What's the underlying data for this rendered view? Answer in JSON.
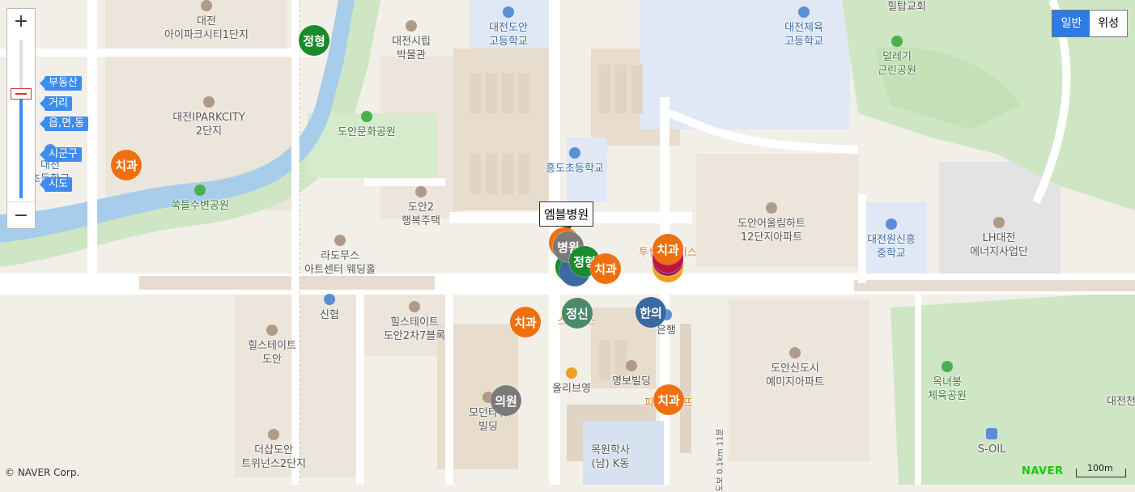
{
  "map_type": {
    "general": "일반",
    "satellite": "위성",
    "selected": "general"
  },
  "zoom": {
    "in": "+",
    "out": "−",
    "labels": [
      "부동산",
      "거리",
      "읍,면,동",
      "시군구",
      "시도"
    ],
    "level_fraction": 0.35
  },
  "tooltip": "엠블병원",
  "places": [
    {
      "name": "대전\n아이파크시티1단지",
      "kind": "bld"
    },
    {
      "name": "대전시립\n박물관",
      "kind": "bld"
    },
    {
      "name": "대전도안\n고등학교",
      "kind": "school"
    },
    {
      "name": "대전체육\n고등학교",
      "kind": "school"
    },
    {
      "name": "힐탑교회",
      "kind": "text"
    },
    {
      "name": "덜레기\n근린공원",
      "kind": "park"
    },
    {
      "name": "대전IPARKCITY\n2단지",
      "kind": "bld"
    },
    {
      "name": "도안문화공원",
      "kind": "park"
    },
    {
      "name": "흥도초등학교",
      "kind": "school"
    },
    {
      "name": "대전\n초등학교",
      "kind": "school"
    },
    {
      "name": "쑥들수변공원",
      "kind": "park"
    },
    {
      "name": "도안2\n행복주택",
      "kind": "bld"
    },
    {
      "name": "도안어울림하트\n12단지아파트",
      "kind": "bld"
    },
    {
      "name": "대전원신흥\n중학교",
      "kind": "school"
    },
    {
      "name": "LH대전\n에너지사업단",
      "kind": "bld"
    },
    {
      "name": "라도무스\n아트센터 웨딩홀",
      "kind": "bld"
    },
    {
      "name": "투썸플레이스",
      "kind": "orange"
    },
    {
      "name": "신협",
      "kind": "bank"
    },
    {
      "name": "힐스테이트\n도안2차7블록",
      "kind": "bld"
    },
    {
      "name": "스타벅스",
      "kind": "orange"
    },
    {
      "name": "은행",
      "kind": "bank"
    },
    {
      "name": "힐스테이트\n도안",
      "kind": "bld"
    },
    {
      "name": "올리브영",
      "kind": "shop"
    },
    {
      "name": "명보빌딩",
      "kind": "bld"
    },
    {
      "name": "도안신도시\n예미지아파트",
      "kind": "bld"
    },
    {
      "name": "옥녀봉\n체육공원",
      "kind": "park"
    },
    {
      "name": "모던타워\n빌딩",
      "kind": "bld"
    },
    {
      "name": "파리바게뜨",
      "kind": "orange"
    },
    {
      "name": "목원학사\n(남) K동",
      "kind": "text"
    },
    {
      "name": "더샵도안\n트위넌스2단지",
      "kind": "bld"
    },
    {
      "name": "S-OIL",
      "kind": "gas"
    },
    {
      "name": "대전천",
      "kind": "text"
    },
    {
      "name": "도보 0.1km 11분",
      "kind": "text"
    }
  ],
  "markers": [
    {
      "label": "정형",
      "color": "#1a8a2a"
    },
    {
      "label": "치과",
      "color": "#f07010"
    },
    {
      "label": "병원",
      "color": "#7a7a7a"
    },
    {
      "label": "정형",
      "color": "#1a8a2a"
    },
    {
      "label": "치과",
      "color": "#f07010"
    },
    {
      "label": "치과",
      "color": "#f07010"
    },
    {
      "label": "치과",
      "color": "#f07010"
    },
    {
      "label": "정신",
      "color": "#4a8a6a"
    },
    {
      "label": "한의",
      "color": "#3a6aa0"
    },
    {
      "label": "의원",
      "color": "#7a7a7a"
    },
    {
      "label": "치과",
      "color": "#f07010"
    }
  ],
  "footer": {
    "copyright": "© NAVER Corp.",
    "logo": "NAVER",
    "scale": "100m"
  }
}
